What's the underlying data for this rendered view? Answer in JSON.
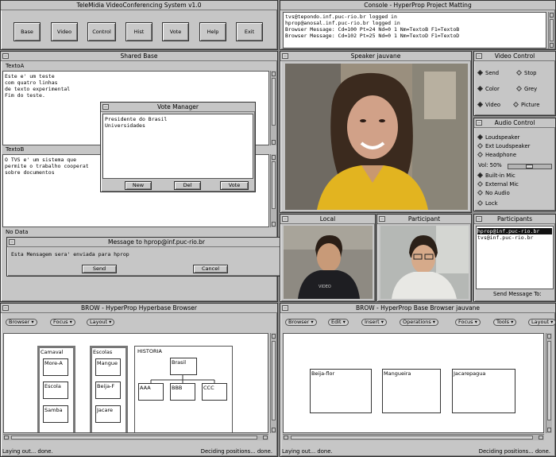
{
  "main_toolbar": {
    "title": "TeleMidia VideoConferencing System v1.0",
    "buttons": [
      "Base",
      "Video",
      "Control",
      "Hist",
      "Vote",
      "Help",
      "Exit"
    ]
  },
  "console": {
    "title": "Console - HyperProp Project Matting",
    "lines": [
      "tvs@tepondo.inf.puc-rio.br logged in",
      "hprop@anosal.inf.puc-rio.br logged in",
      "Browser Message: Cd=100 Pt=24 Nd=0 1 Nm=TextoB F1=TextoB",
      "Browser Message: Cd=102 Pt=25 Nd=0 1 Nm=TextoD F1=TextoD"
    ]
  },
  "shared_base": {
    "title": "Shared Base",
    "texto_a_label": "TextoA",
    "texto_a_lines": [
      "Este e' um teste",
      "com quatro linhas",
      "de texto experimental",
      "Fim do teste."
    ],
    "texto_b_label": "TextoB",
    "texto_b_lines": [
      "O TVS e' um sistema que",
      "permite o trabalho cooperat",
      "sobre documentos"
    ],
    "no_data_label": "No Data"
  },
  "vote_manager": {
    "title": "Vote Manager",
    "items": [
      "Presidente do Brasil",
      "Universidades"
    ],
    "buttons": [
      "New",
      "Del",
      "Vote"
    ]
  },
  "message_dialog": {
    "title": "Message to hprop@inf.puc-rio.br",
    "input_value": "Esta Mensagem sera' enviada para hprop",
    "buttons": [
      "Send",
      "Cancel"
    ]
  },
  "speaker": {
    "title": "Speaker  jauvane"
  },
  "video_control": {
    "title": "Video Control",
    "options": [
      {
        "label": "Send",
        "on": true
      },
      {
        "label": "Stop",
        "on": false
      },
      {
        "label": "Color",
        "on": true
      },
      {
        "label": "Grey",
        "on": false
      },
      {
        "label": "Video",
        "on": true
      },
      {
        "label": "Picture",
        "on": false
      }
    ]
  },
  "audio_control": {
    "title": "Audio Control",
    "outputs": [
      "Loudspeaker",
      "Ext Loudspeaker",
      "Headphone"
    ],
    "volume_label": "Vol: 50%",
    "inputs": [
      "Built-in Mic",
      "External Mic",
      "No Audio"
    ],
    "lock_label": "Lock"
  },
  "local": {
    "title": "Local"
  },
  "participant": {
    "title": "Participant"
  },
  "participants": {
    "title": "Participants",
    "items": [
      "hprop@inf.puc-rio.br",
      "tvs@inf.puc-rio.br"
    ],
    "send_label": "Send Message To:"
  },
  "hyperbase_browser": {
    "title": "BROW - HyperProp Hyperbase Browser",
    "menus": [
      "Browser",
      "Focus",
      "Layout"
    ],
    "status_left": "Laying out... done.",
    "status_right": "Deciding positions... done.",
    "contexts": [
      {
        "label": "Camaval",
        "nodes": [
          "More-A",
          "Escola",
          "Samba"
        ]
      },
      {
        "label": "Escolas",
        "nodes": [
          "Mangue",
          "Beija-F",
          "Jacare"
        ]
      }
    ],
    "historia": {
      "label": "HISTORIA",
      "root": "Brasil",
      "children": [
        "AAA",
        "BBB",
        "CCC"
      ]
    }
  },
  "base_browser": {
    "title": "BROW - HyperProp Base Browser jauvane",
    "menus": [
      "Browser",
      "Edit",
      "Insert",
      "Operations",
      "Focus",
      "Tools",
      "Layout"
    ],
    "nodes": [
      "Beija-flor",
      "Mangueira",
      "Jacarepagua"
    ],
    "status_left": "Laying out... done.",
    "status_right": "Deciding positions... done."
  }
}
